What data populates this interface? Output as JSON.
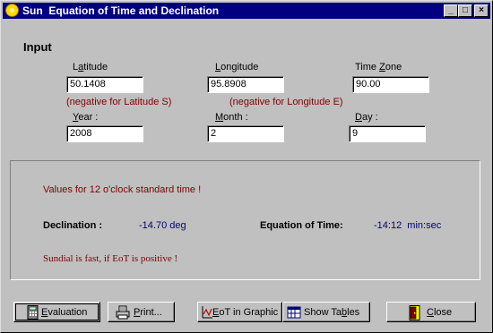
{
  "window": {
    "title": "Sun  Equation of Time and Declination",
    "min_label": "_",
    "max_label": "□",
    "close_label": "×"
  },
  "input_section": {
    "heading": "Input",
    "latitude": {
      "pre": "L",
      "accel": "a",
      "post": "titude",
      "value": "50.1408",
      "note": "(negative for Latitude S)"
    },
    "longitude": {
      "pre": "",
      "accel": "L",
      "post": "ongitude",
      "value": "95.8908",
      "note": "(negative for Longitude E)"
    },
    "timezone": {
      "pre": "Time ",
      "accel": "Z",
      "post": "one",
      "value": "90.00"
    },
    "year": {
      "pre": "",
      "accel": "Y",
      "post": "ear :",
      "value": "2008"
    },
    "month": {
      "pre": "",
      "accel": "M",
      "post": "onth :",
      "value": "2"
    },
    "day": {
      "pre": "",
      "accel": "D",
      "post": "ay :",
      "value": "9"
    }
  },
  "results": {
    "values_note": "Values for 12 o'clock standard time !",
    "declination_label": "Declination :",
    "declination_value": "-14.70 deg",
    "eot_label": "Equation of Time:",
    "eot_value": "-14:12  min:sec",
    "sundial_note": "Sundial is fast, if EoT is positive !"
  },
  "buttons": {
    "evaluation": {
      "pre": "",
      "accel": "E",
      "post": "valuation"
    },
    "print": {
      "pre": "",
      "accel": "P",
      "post": "rint..."
    },
    "eot_graphic": {
      "pre": "",
      "accel": "E",
      "post": "oT in Graphic"
    },
    "show_tables": {
      "pre": "Show Ta",
      "accel": "b",
      "post": "les"
    },
    "close": {
      "pre": "",
      "accel": "C",
      "post": "lose"
    }
  },
  "colors": {
    "title_bar": "#000080",
    "note_red": "#800000",
    "value_blue": "#000080"
  }
}
